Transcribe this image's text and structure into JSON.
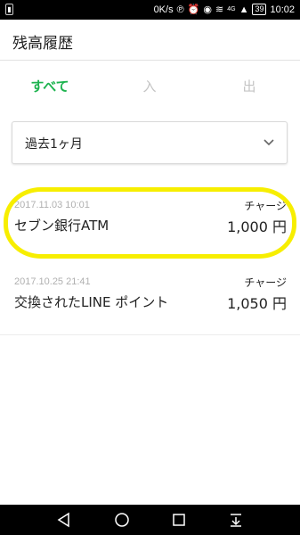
{
  "status_bar": {
    "network_speed": "0K/s",
    "signal_label": "4G",
    "battery": "39",
    "time": "10:02"
  },
  "header": {
    "title": "残高履歴"
  },
  "tabs": [
    {
      "label": "すべて",
      "active": true
    },
    {
      "label": "入",
      "active": false
    },
    {
      "label": "出",
      "active": false
    }
  ],
  "filter": {
    "period": "過去1ヶ月"
  },
  "history": [
    {
      "date": "2017.11.03 10:01",
      "type": "チャージ",
      "name": "セブン銀行ATM",
      "amount": "1,000 円",
      "highlighted": true
    },
    {
      "date": "2017.10.25 21:41",
      "type": "チャージ",
      "name": "交換されたLINE ポイント",
      "amount": "1,050 円",
      "highlighted": false
    }
  ],
  "colors": {
    "accent": "#1db34f",
    "highlight": "#f7ee00",
    "inactive_tab": "#c4c4c4"
  }
}
